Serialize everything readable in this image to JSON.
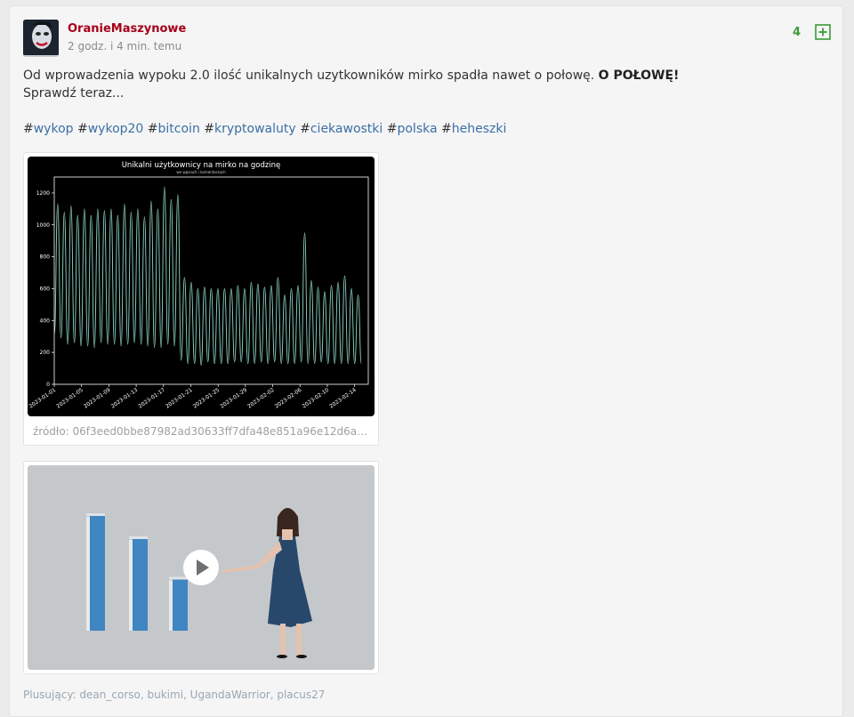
{
  "post": {
    "author": "OranieMaszynowe",
    "time": "2 godz. i 4 min. temu",
    "votes": "4",
    "text_main": "Od wprowadzenia wypoku 2.0 ilość unikalnych uzytkowników mirko spadła nawet o połowę.",
    "text_bold": "O POŁOWĘ!",
    "text_line2": "Sprawdź teraz...",
    "tags": [
      "wykop",
      "wykop20",
      "bitcoin",
      "kryptowaluty",
      "ciekawostki",
      "polska",
      "heheszki"
    ],
    "source": "źródło: 06f3eed0bbe87982ad30633ff7dfa48e851a96e12d6a2e342...",
    "plusers_label": "Plusujący:",
    "plusers": [
      "dean_corso",
      "bukimi",
      "UgandaWarrior",
      "placus27"
    ]
  },
  "colors": {
    "author": "#a6001a",
    "vote": "#3a9b3a",
    "tag": "#3b6fa6",
    "chart_bg": "#000000",
    "chart_line": "#8fd9c6"
  },
  "chart_data": {
    "type": "line",
    "title": "Unikalni użytkownicy na mirko na godzinę",
    "subtitle": "we wpisach i komentarzach",
    "x_ticks": [
      "2023-01-01",
      "2023-01-05",
      "2023-01-09",
      "2023-01-13",
      "2023-01-17",
      "2023-01-21",
      "2023-01-25",
      "2023-01-29",
      "2023-02-02",
      "2023-02-06",
      "2023-02-10",
      "2023-02-14"
    ],
    "y_ticks": [
      0,
      200,
      400,
      600,
      800,
      1000,
      1200
    ],
    "ylim": [
      0,
      1300
    ],
    "xlim": [
      "2023-01-01",
      "2023-02-16"
    ],
    "grid": false,
    "series": [
      {
        "peaks": [
          1130,
          1080,
          1120,
          1060,
          1100,
          1060,
          1100,
          1090,
          1100,
          1060,
          1130,
          1080,
          1100,
          1050,
          1150,
          1100,
          1240,
          1160,
          1190,
          670,
          640,
          600,
          610,
          600,
          600,
          600,
          600,
          620,
          600,
          640,
          630,
          610,
          620,
          670,
          560,
          600,
          620,
          950,
          650,
          610,
          580,
          620,
          640,
          680,
          600,
          560
        ],
        "troughs": [
          310,
          290,
          250,
          260,
          240,
          240,
          230,
          260,
          250,
          250,
          240,
          250,
          260,
          250,
          240,
          230,
          230,
          250,
          240,
          150,
          130,
          130,
          120,
          140,
          130,
          130,
          130,
          140,
          140,
          130,
          130,
          140,
          130,
          140,
          130,
          130,
          130,
          140,
          130,
          130,
          140,
          130,
          130,
          130,
          130,
          130
        ]
      }
    ]
  },
  "video": {
    "bars": [
      {
        "value": 1.0
      },
      {
        "value": 0.8
      },
      {
        "value": 0.45
      }
    ]
  }
}
